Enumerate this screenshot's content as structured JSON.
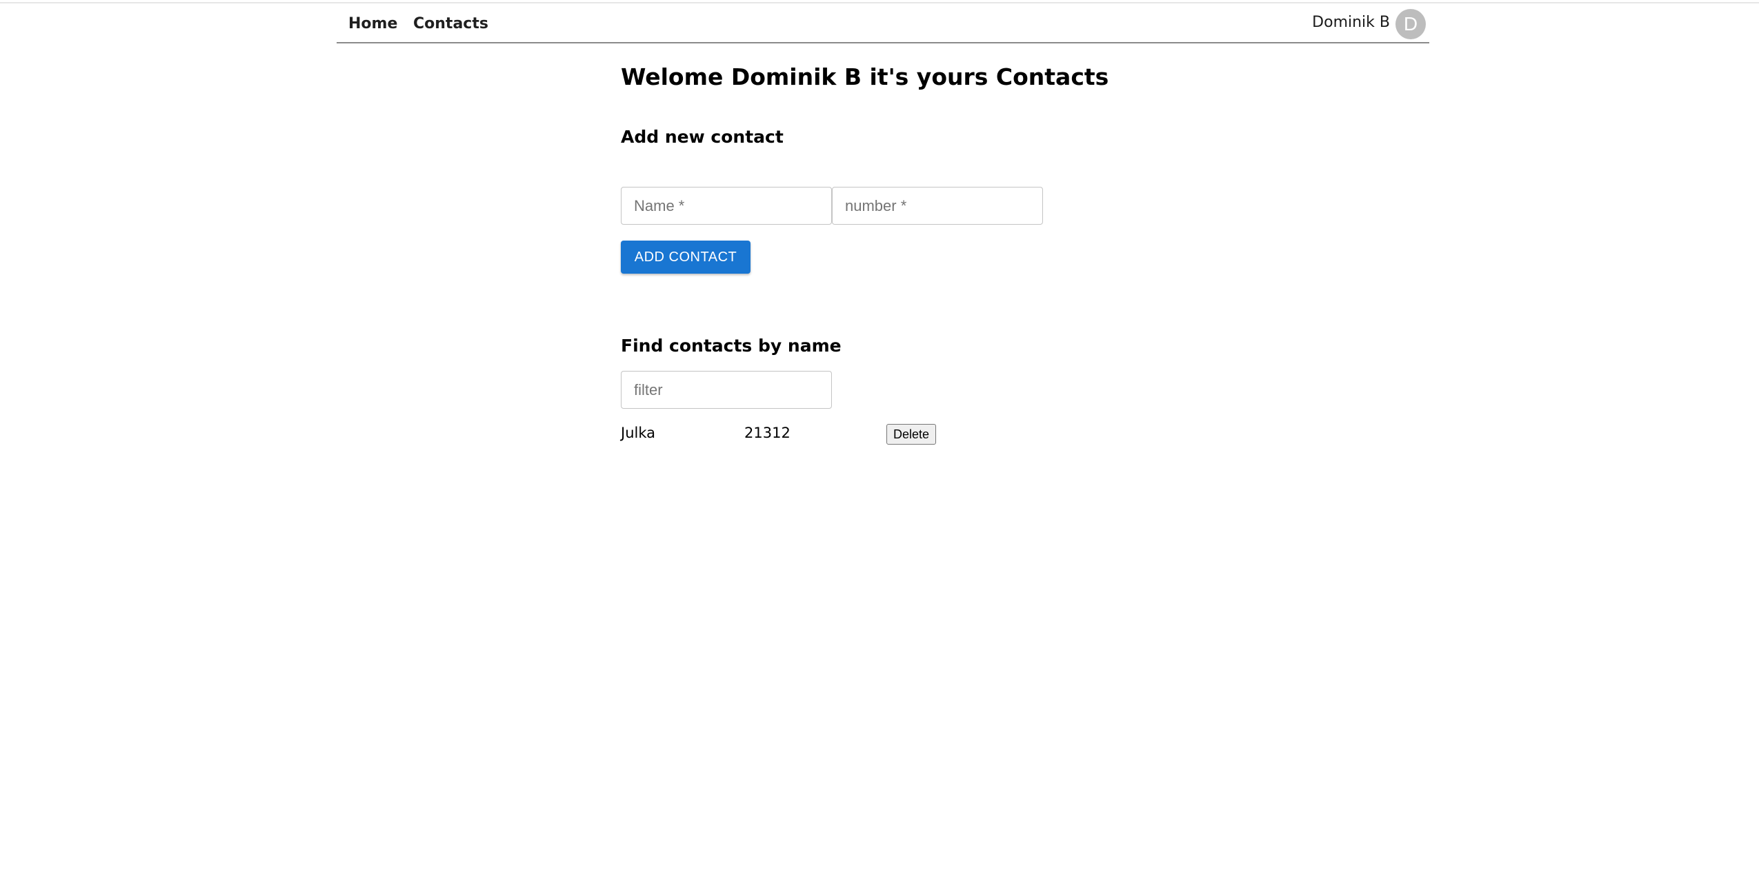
{
  "nav": {
    "home_label": "Home",
    "contacts_label": "Contacts"
  },
  "user": {
    "name": "Dominik B",
    "avatar_initial": "D"
  },
  "page": {
    "title": "Welome Dominik B it's yours Contacts"
  },
  "add_form": {
    "heading": "Add new contact",
    "name_placeholder": "Name *",
    "number_placeholder": "number *",
    "name_value": "",
    "number_value": "",
    "submit_label": "ADD CONTACT"
  },
  "filter": {
    "heading": "Find contacts by name",
    "placeholder": "filter",
    "value": ""
  },
  "contacts": [
    {
      "name": "Julka",
      "number": "21312",
      "delete_label": "Delete"
    }
  ],
  "colors": {
    "primary_button": "#1976d2",
    "avatar_bg": "#bdbdbd",
    "nav_border": "#8a8a8a"
  }
}
